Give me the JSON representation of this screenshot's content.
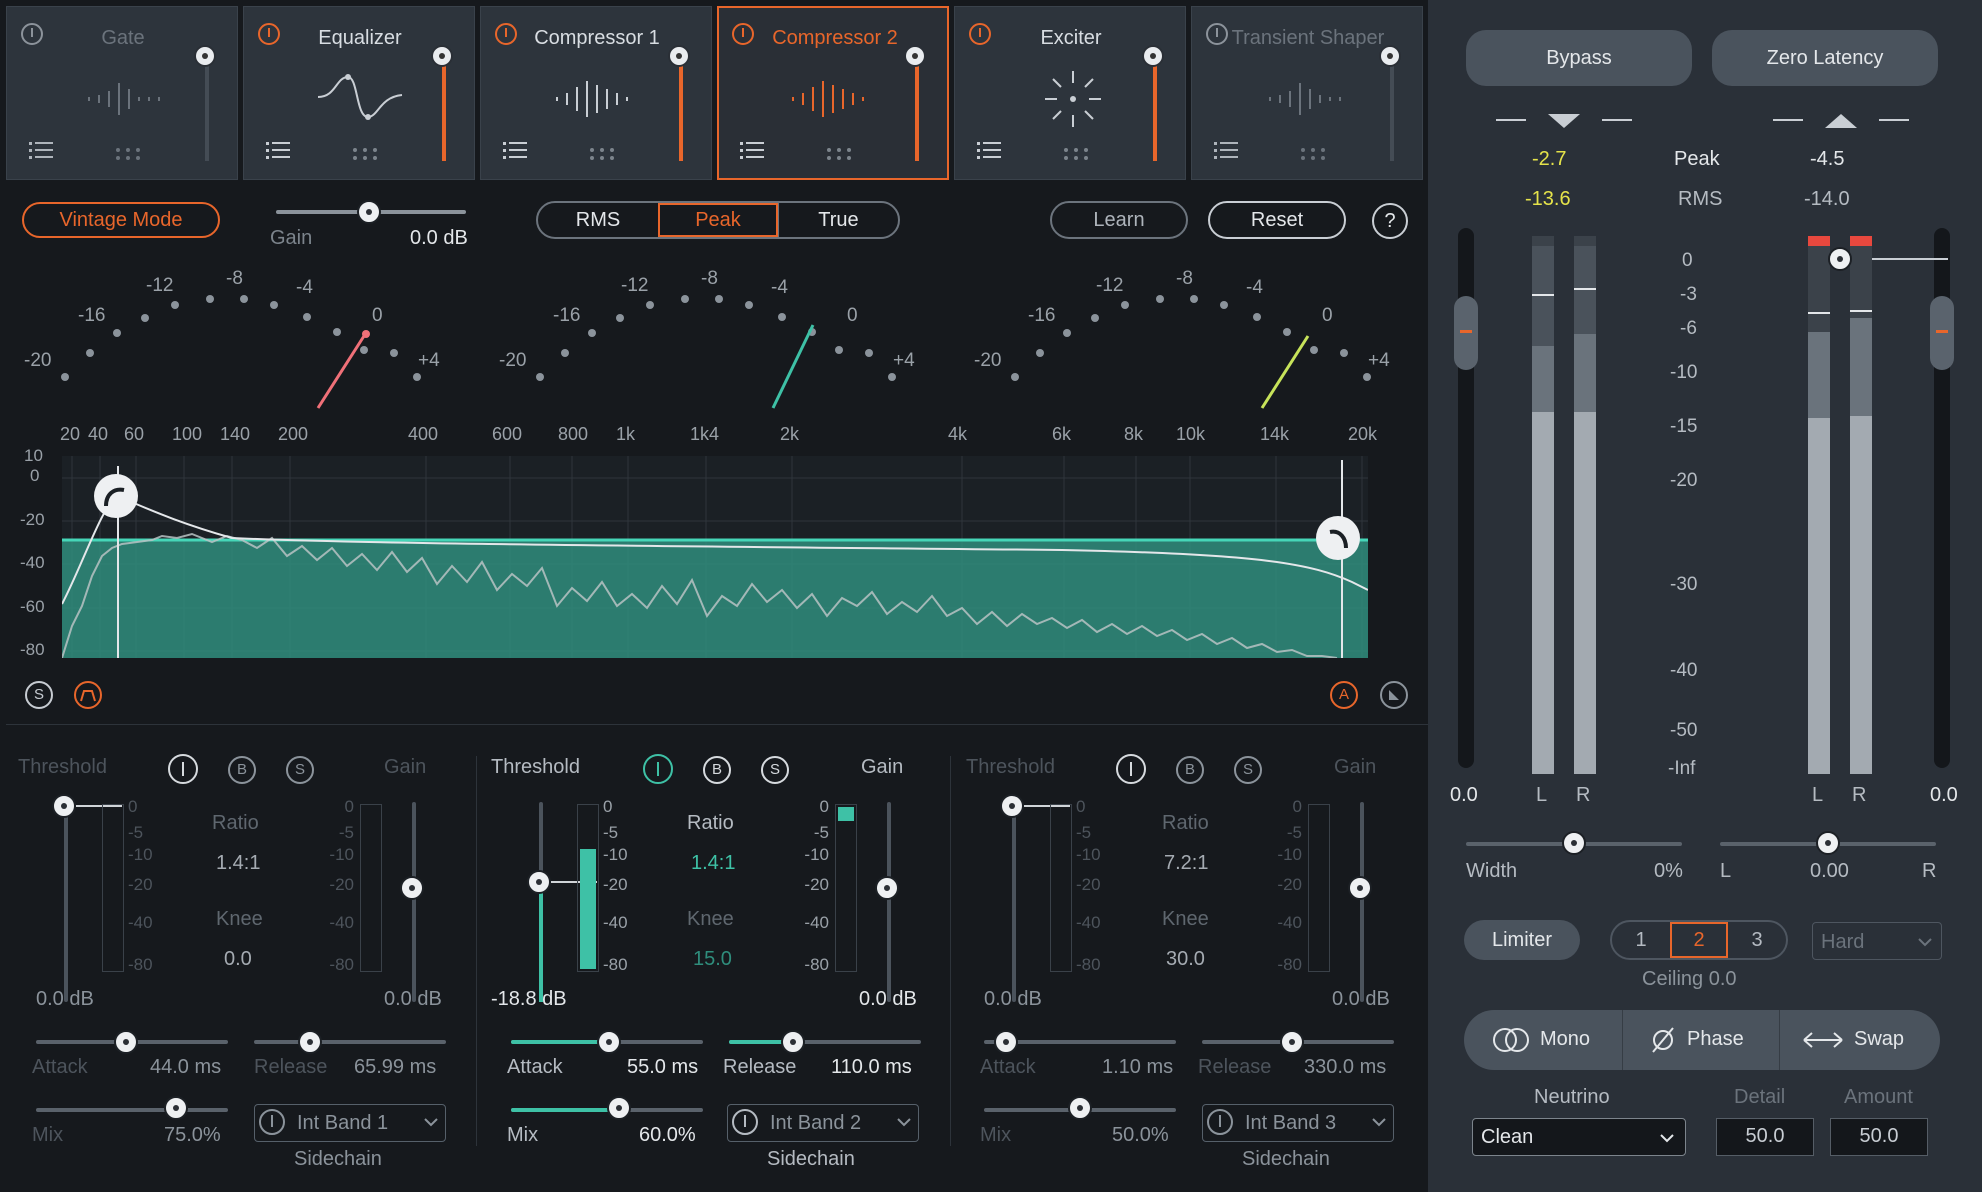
{
  "modules": [
    {
      "name": "Gate",
      "state": "off"
    },
    {
      "name": "Equalizer",
      "state": "on"
    },
    {
      "name": "Compressor 1",
      "state": "on"
    },
    {
      "name": "Compressor 2",
      "state": "selected"
    },
    {
      "name": "Exciter",
      "state": "on"
    },
    {
      "name": "Transient Shaper",
      "state": "off"
    }
  ],
  "toolbar": {
    "vintage_mode": "Vintage Mode",
    "gain_label": "Gain",
    "gain_value": "0.0 dB",
    "rms": "RMS",
    "peak": "Peak",
    "true": "True",
    "learn": "Learn",
    "reset": "Reset",
    "help": "?"
  },
  "dial_scale": {
    "labels": [
      "-20",
      "-16",
      "-12",
      "-8",
      "-4",
      "0",
      "+4"
    ]
  },
  "freq_labels": [
    "20",
    "40",
    "60",
    "100",
    "140",
    "200",
    "400",
    "600",
    "800",
    "1k",
    "1k4",
    "2k",
    "4k",
    "6k",
    "8k",
    "10k",
    "14k",
    "20k"
  ],
  "db_labels": [
    "10",
    "0",
    "-20",
    "-40",
    "-60",
    "-80"
  ],
  "spectrum_buttons": {
    "solo": "S",
    "alt": "A"
  },
  "bands": [
    {
      "threshold_label": "Threshold",
      "gain_label": "Gain",
      "ratio_label": "Ratio",
      "ratio": "1.4:1",
      "knee_label": "Knee",
      "knee": "0.0",
      "threshold_value": "0.0 dB",
      "gain_value": "0.0 dB",
      "attack_label": "Attack",
      "attack": "44.0",
      "release_label": "Release",
      "release": "65.99",
      "mix_label": "Mix",
      "mix": "75.0%",
      "sidechain": "Int Band 1",
      "sidechain_label": "Sidechain",
      "active": false
    },
    {
      "threshold_label": "Threshold",
      "gain_label": "Gain",
      "ratio_label": "Ratio",
      "ratio": "1.4:1",
      "knee_label": "Knee",
      "knee": "15.0",
      "threshold_value": "-18.8 dB",
      "gain_value": "0.0 dB",
      "attack_label": "Attack",
      "attack": "55.0",
      "release_label": "Release",
      "release": "110.0",
      "mix_label": "Mix",
      "mix": "60.0%",
      "sidechain": "Int Band 2",
      "sidechain_label": "Sidechain",
      "active": true
    },
    {
      "threshold_label": "Threshold",
      "gain_label": "Gain",
      "ratio_label": "Ratio",
      "ratio": "7.2:1",
      "knee_label": "Knee",
      "knee": "30.0",
      "threshold_value": "0.0 dB",
      "gain_value": "0.0 dB",
      "attack_label": "Attack",
      "attack": "1.10",
      "release_label": "Release",
      "release": "330.0",
      "mix_label": "Mix",
      "mix": "50.0%",
      "sidechain": "Int Band 3",
      "sidechain_label": "Sidechain",
      "active": false
    }
  ],
  "band_scale": [
    "0",
    "-5",
    "-10",
    "-20",
    "-40",
    "-80"
  ],
  "band_buttons": {
    "bypass": "B",
    "solo": "S"
  },
  "ms_unit": "ms",
  "right": {
    "bypass": "Bypass",
    "zero_latency": "Zero Latency",
    "in_peak": "-2.7",
    "in_rms": "-13.6",
    "peak_label": "Peak",
    "rms_label": "RMS",
    "out_peak": "-4.5",
    "out_rms": "-14.0",
    "scale": [
      "0",
      "-3",
      "-6",
      "-10",
      "-15",
      "-20",
      "-30",
      "-40",
      "-50",
      "-Inf"
    ],
    "in_gain": "0.0",
    "out_gain": "0.0",
    "L": "L",
    "R": "R",
    "width_label": "Width",
    "width_value": "0%",
    "balance_L": "L",
    "balance_value": "0.00",
    "balance_R": "R",
    "limiter": "Limiter",
    "modes": [
      "1",
      "2",
      "3"
    ],
    "mode_selected": "2",
    "knee_option": "Hard",
    "ceiling": "Ceiling 0.0",
    "mono": "Mono",
    "phase": "Phase",
    "swap": "Swap",
    "neutrino_label": "Neutrino",
    "neutrino_value": "Clean",
    "detail_label": "Detail",
    "detail_value": "50.0",
    "amount_label": "Amount",
    "amount_value": "50.0"
  },
  "colors": {
    "accent": "#e8662b",
    "teal": "#3ec1a6",
    "yellow": "#e5e34a"
  }
}
